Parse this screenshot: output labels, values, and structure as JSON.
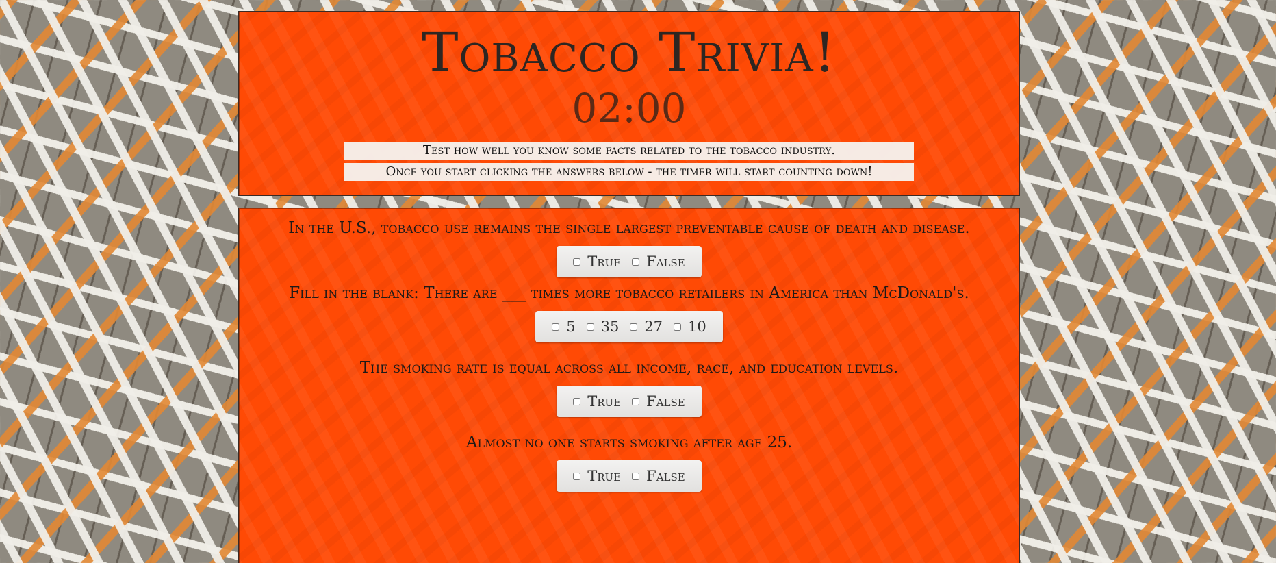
{
  "header": {
    "title": "Tobacco Trivia!",
    "timer": "02:00",
    "info_line_1": "Test how well you know some facts related to the tobacco industry.",
    "info_line_2": "Once you start clicking the answers below - the timer will start counting down!"
  },
  "questions": [
    {
      "text": "In the U.S., tobacco use remains the single largest preventable cause of death and disease.",
      "options": [
        "True",
        "False"
      ]
    },
    {
      "text": "Fill in the blank: There are ___ times more tobacco retailers in America than McDonald's.",
      "options": [
        "5",
        "35",
        "27",
        "10"
      ]
    },
    {
      "text": "The smoking rate is equal across all income, race, and education levels.",
      "options": [
        "True",
        "False"
      ]
    },
    {
      "text": "Almost no one starts smoking after age 25.",
      "options": [
        "True",
        "False"
      ]
    }
  ],
  "colors": {
    "panel": "#ff4a05",
    "title_text": "#2d2622",
    "timer_text": "#5b2a16"
  }
}
